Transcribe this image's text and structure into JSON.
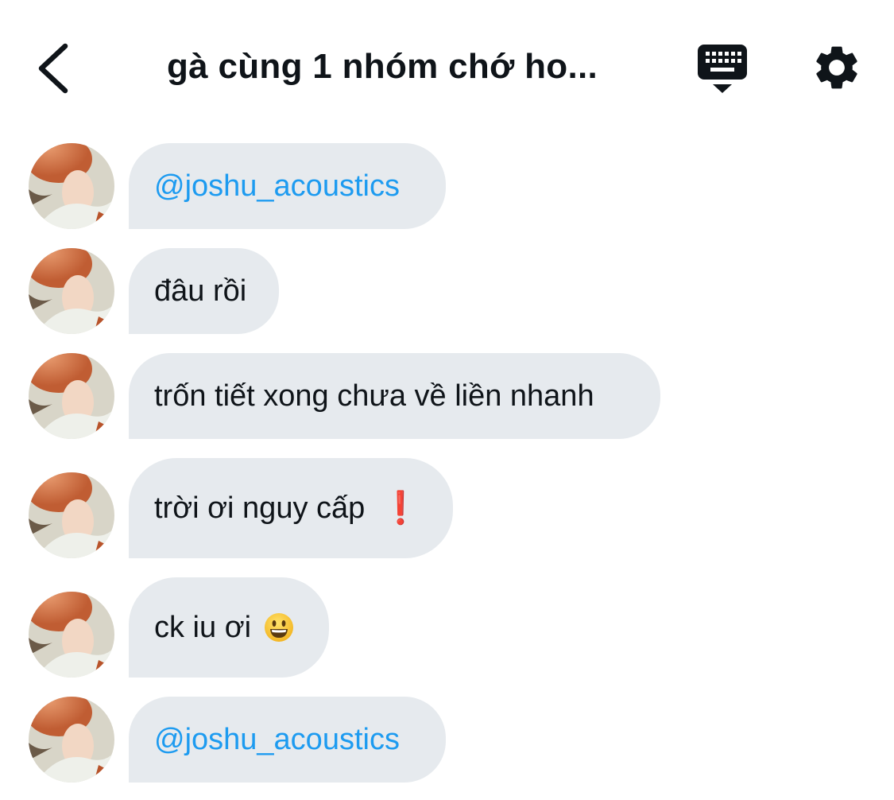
{
  "header": {
    "title": "gà cùng 1 nhóm chớ ho...",
    "back_icon": "chevron-left-icon",
    "keyboard_icon": "keyboard-icon",
    "settings_icon": "gear-icon"
  },
  "colors": {
    "bubble": "#e6eaee",
    "mention": "#1d9bf0",
    "text": "#0f1419",
    "exclamation": "#e0242c"
  },
  "messages": [
    {
      "text": "@joshu_acoustics",
      "type": "mention"
    },
    {
      "text": "đâu rồi",
      "type": "text"
    },
    {
      "text": "trốn tiết xong chưa về liền nhanh",
      "type": "text"
    },
    {
      "text": "trời ơi nguy cấp",
      "emoji": "❗",
      "type": "text"
    },
    {
      "text": "ck iu ơi",
      "emoji": "😃",
      "type": "text"
    },
    {
      "text": "@joshu_acoustics",
      "type": "mention"
    }
  ]
}
